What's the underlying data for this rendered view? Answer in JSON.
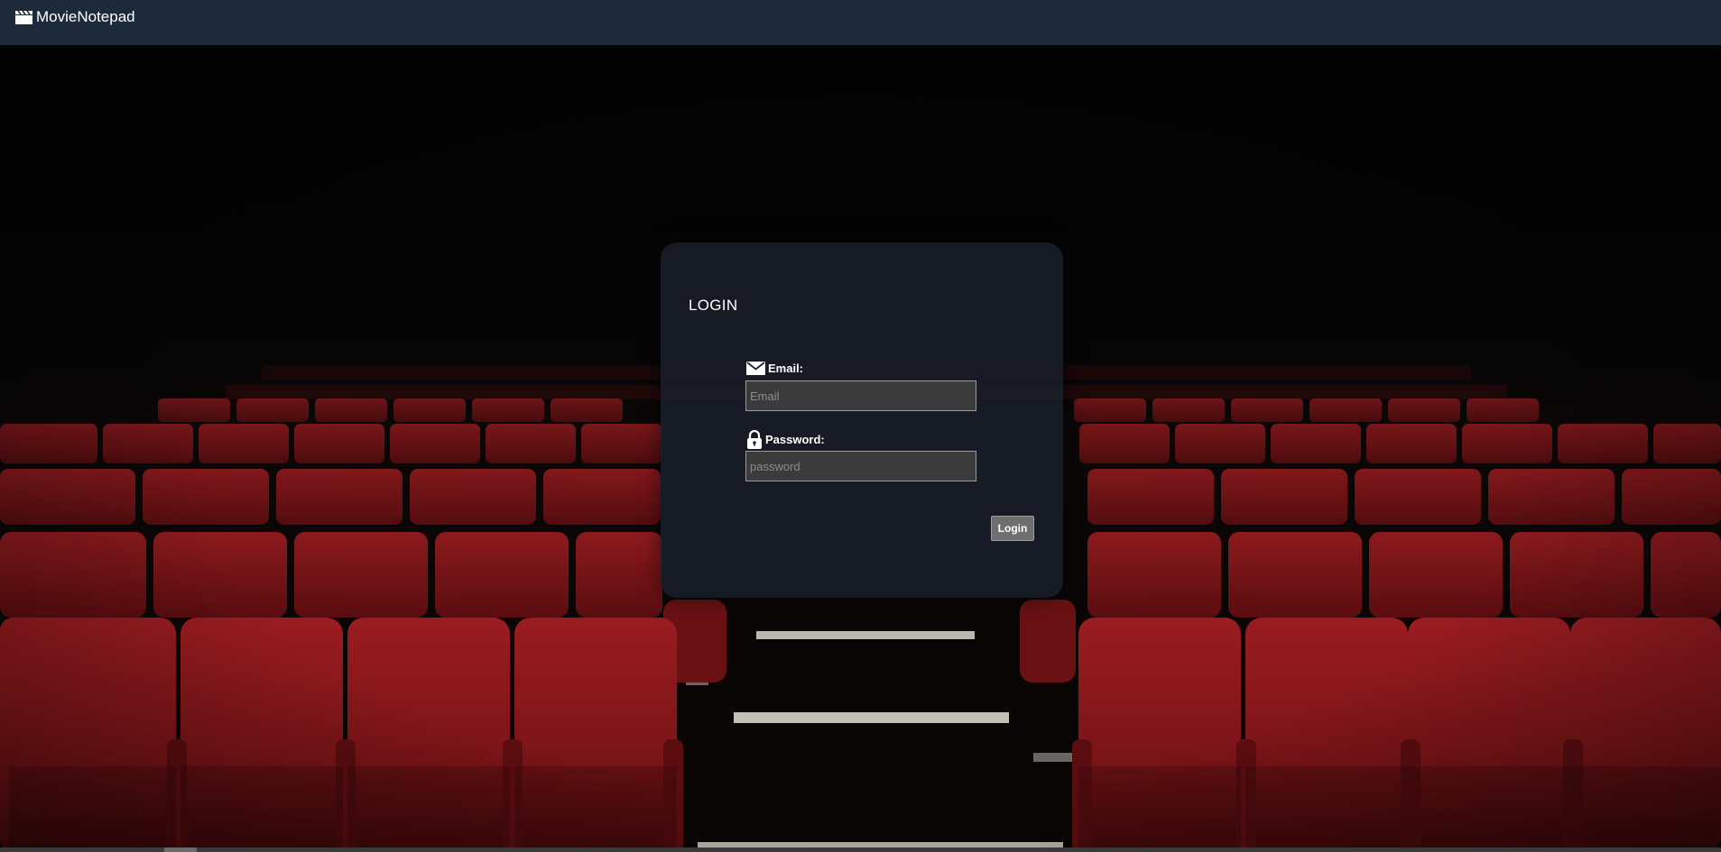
{
  "app": {
    "brand": "MovieNotepad",
    "brand_icon": "clapperboard-icon"
  },
  "login": {
    "title": "LOGIN",
    "email_label": "Email:",
    "email_icon": "envelope-icon",
    "email_placeholder": "Email",
    "email_value": "",
    "password_label": "Password:",
    "password_icon": "lock-icon",
    "password_placeholder": "password",
    "password_value": "",
    "submit_label": "Login"
  },
  "colors": {
    "navbar": "#1c2a3a",
    "card": "#181e2a",
    "seat_red": "#7e1518",
    "button": "#6f6f6f"
  }
}
